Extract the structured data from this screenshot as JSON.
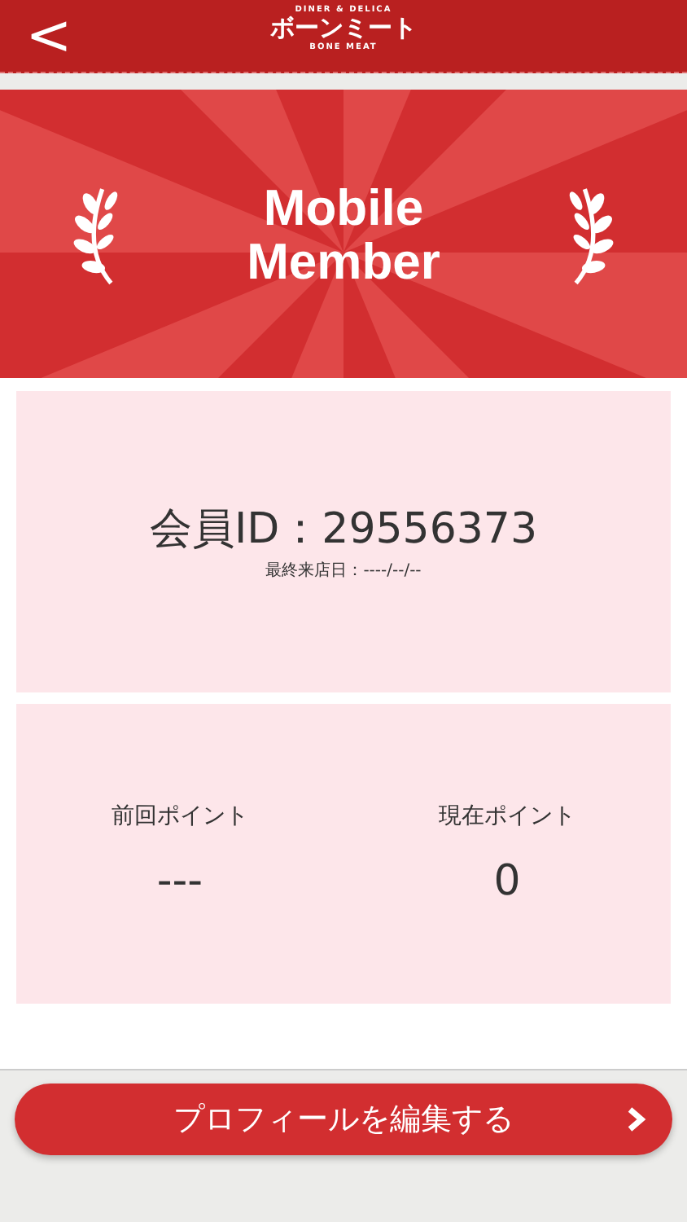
{
  "header": {
    "back": "<",
    "logo": {
      "tagline": "DINER & DELICA",
      "name": "ボーンミート",
      "subtitle": "BONE MEAT"
    }
  },
  "banner": {
    "title": "Mobile Member"
  },
  "member_card": {
    "id": "会員ID：29556373",
    "last_visit": "最終来店日：----/--/--"
  },
  "points": [
    {
      "label": "前回ポイント",
      "value": "---"
    },
    {
      "label": "現在ポイント",
      "value": "0"
    }
  ],
  "edit_button": {
    "label": "プロフィールを編集する"
  }
}
